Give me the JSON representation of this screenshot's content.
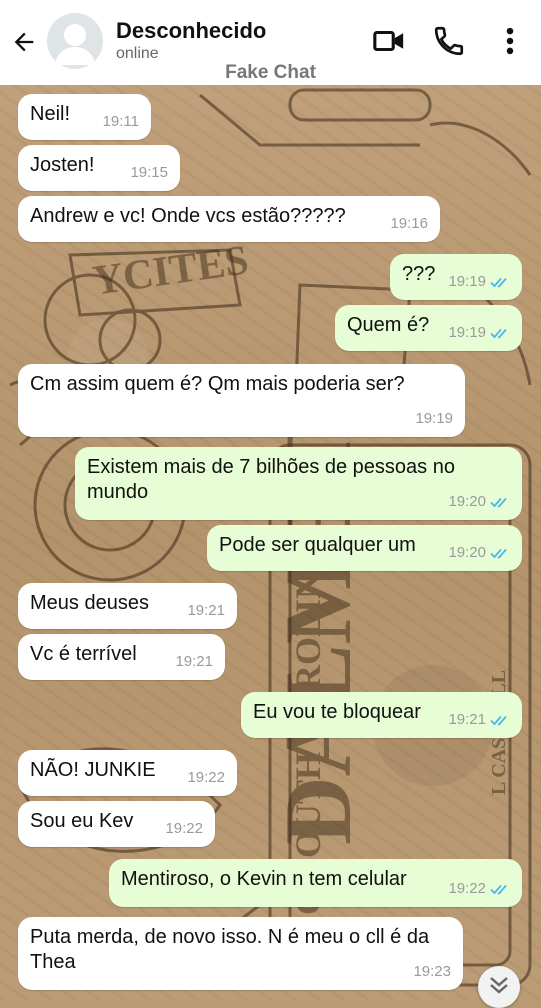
{
  "header": {
    "contact_name": "Desconhecido",
    "status": "online",
    "watermark": "Fake Chat"
  },
  "colors": {
    "incoming_bubble": "#ffffff",
    "outgoing_bubble": "#e6fdd6",
    "read_ticks": "#4fb6ec"
  },
  "messages": [
    {
      "dir": "in",
      "text": "Neil!",
      "time": "19:11"
    },
    {
      "dir": "in",
      "text": "Josten!",
      "time": "19:15"
    },
    {
      "dir": "in",
      "text": "Andrew e vc! Onde vcs estão?????",
      "time": "19:16"
    },
    {
      "dir": "out",
      "text": "???",
      "time": "19:19",
      "status": "read"
    },
    {
      "dir": "out",
      "text": "Quem é?",
      "time": "19:19",
      "status": "read"
    },
    {
      "dir": "in",
      "text": "Cm assim quem é? Qm mais poderia ser?",
      "time": "19:19"
    },
    {
      "dir": "out",
      "text": "Existem mais de 7 bilhões de pessoas no mundo",
      "time": "19:20",
      "status": "read"
    },
    {
      "dir": "out",
      "text": "Pode ser qualquer um",
      "time": "19:20",
      "status": "read"
    },
    {
      "dir": "in",
      "text": "Meus deuses",
      "time": "19:21"
    },
    {
      "dir": "in",
      "text": "Vc é terrível",
      "time": "19:21"
    },
    {
      "dir": "out",
      "text": "Eu vou te bloquear",
      "time": "19:21",
      "status": "read"
    },
    {
      "dir": "in",
      "text": "NÃO! JUNKIE",
      "time": "19:22"
    },
    {
      "dir": "in",
      "text": "Sou eu Kev",
      "time": "19:22"
    },
    {
      "dir": "out",
      "text": "Mentiroso, o Kevin n tem celular",
      "time": "19:22",
      "status": "read"
    },
    {
      "dir": "in",
      "text": "Puta merda, de novo isso. N é meu o cll é da Thea",
      "time": "19:23"
    }
  ]
}
